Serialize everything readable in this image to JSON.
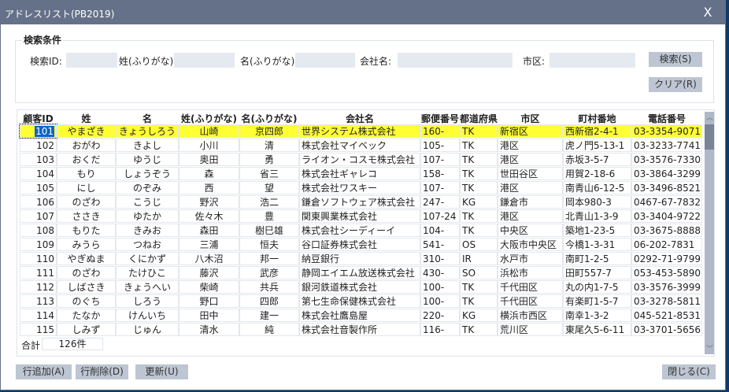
{
  "window": {
    "title": "アドレスリスト(PB2019)",
    "close_label": "X"
  },
  "search": {
    "group_title": "検索条件",
    "id_label": "検索ID:",
    "id_value": "",
    "sei_label": "姓(ふりがな):",
    "sei_value": "",
    "mei_label": "名(ふりがな):",
    "mei_value": "",
    "company_label": "会社名:",
    "company_value": "",
    "city_label": "市区:",
    "city_value": "",
    "search_button": "検索(S)",
    "clear_button": "クリア(R)"
  },
  "table": {
    "columns": [
      "顧客ID",
      "姓",
      "名",
      "姓(ふりがな)",
      "名(ふりがな)",
      "会社名",
      "郵便番号",
      "都道府県",
      "市区",
      "町村番地",
      "電話番号"
    ],
    "selected_id": "101",
    "rows": [
      [
        "101",
        "やまざき",
        "きょうしろう",
        "山崎",
        "京四郎",
        "世界システム株式会社",
        "160-",
        "TK",
        "新宿区",
        "西新宿2-4-1",
        "03-3354-9071"
      ],
      [
        "102",
        "おがわ",
        "きよし",
        "小川",
        "清",
        "株式会社マイベック",
        "105-",
        "TK",
        "港区",
        "虎ノ門5-13-1",
        "03-3233-7741"
      ],
      [
        "103",
        "おくだ",
        "ゆうじ",
        "奥田",
        "勇",
        "ライオン・コスモ株式会社",
        "107-",
        "TK",
        "港区",
        "赤坂3-5-7",
        "03-3576-7330"
      ],
      [
        "104",
        "もり",
        "しょうぞう",
        "森",
        "省三",
        "株式会社ギャレコ",
        "158-",
        "TK",
        "世田谷区",
        "用賀2-18-6",
        "03-3864-3299"
      ],
      [
        "105",
        "にし",
        "のぞみ",
        "西",
        "望",
        "株式会社ワスキー",
        "107-",
        "TK",
        "港区",
        "南青山6-12-5",
        "03-3496-8521"
      ],
      [
        "106",
        "のざわ",
        "こうじ",
        "野沢",
        "浩二",
        "鎌倉ソフトウェア株式会社",
        "247-",
        "KG",
        "鎌倉市",
        "岡本980-3",
        "0467-67-7832"
      ],
      [
        "107",
        "ささき",
        "ゆたか",
        "佐々木",
        "豊",
        "関東興業株式会社",
        "107-24",
        "TK",
        "港区",
        "北青山1-3-9",
        "03-3404-9722"
      ],
      [
        "108",
        "もりた",
        "きみお",
        "森田",
        "樹巳雄",
        "株式会社シーディーイ",
        "104-",
        "TK",
        "中央区",
        "築地1-23-5",
        "03-3675-8888"
      ],
      [
        "109",
        "みうら",
        "つねお",
        "三浦",
        "恒夫",
        "谷口証券株式会社",
        "541-",
        "OS",
        "大阪市中央区",
        "今橋1-3-31",
        "06-202-7831"
      ],
      [
        "110",
        "やぎぬま",
        "くにかず",
        "八木沼",
        "邦一",
        "納豆銀行",
        "310-",
        "IR",
        "水戸市",
        "南町1-2-5",
        "0292-71-9799"
      ],
      [
        "111",
        "のざわ",
        "たけひこ",
        "藤沢",
        "武彦",
        "静岡エイエム放送株式会社",
        "430-",
        "SO",
        "浜松市",
        "田町557-7",
        "053-453-5890"
      ],
      [
        "112",
        "しばさき",
        "きょうへい",
        "柴崎",
        "共兵",
        "銀河鉄道株式会社",
        "100-",
        "TK",
        "千代田区",
        "丸の内1-7-5",
        "03-3576-3999"
      ],
      [
        "113",
        "のぐち",
        "しろう",
        "野口",
        "四郎",
        "第七生命保健株式会社",
        "100-",
        "TK",
        "千代田区",
        "有楽町1-5-7",
        "03-3278-5811"
      ],
      [
        "114",
        "たなか",
        "けんいち",
        "田中",
        "建一",
        "株式会社鷹島屋",
        "220-",
        "KG",
        "横浜市西区",
        "南幸1-3-2",
        "045-521-8531"
      ],
      [
        "115",
        "しみず",
        "じゅん",
        "清水",
        "純",
        "株式会社音製作所",
        "116-",
        "TK",
        "荒川区",
        "東尾久5-6-11",
        "03-3701-5656"
      ]
    ],
    "total_label": "合計",
    "total_value": "126件"
  },
  "footer": {
    "add_row": "行追加(A)",
    "delete_row": "行削除(D)",
    "update": "更新(U)",
    "close": "閉じる(C)"
  },
  "colors": {
    "titlebar": "#647189",
    "selected_row": "#ffff33",
    "button": "#bdc6d2",
    "input": "#e5eaf1"
  }
}
